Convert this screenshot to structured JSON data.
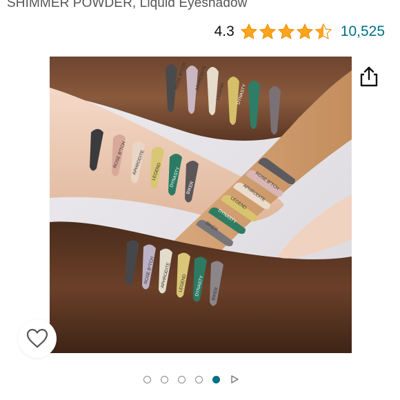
{
  "product": {
    "title": "SHIMMER POWDER, Liquid Eyeshadow"
  },
  "rating": {
    "value": "4.3",
    "stars": 4.3,
    "count": "10,525",
    "star_color": "#ffa41c"
  },
  "swatches": {
    "arm_top": [
      "ROSE B*TCH",
      "APHRODITE",
      "LEGEND",
      "DYNASTY"
    ],
    "arm_left": [
      "ROSE B*TCH",
      "APHRODITE",
      "LEGEND",
      "DYNASTY",
      "BIKER"
    ],
    "arm_right": [
      "ROSE B*TCH",
      "APHRODITE",
      "LEGEND",
      "DYNASTY",
      "BIKER"
    ],
    "arm_bottom": [
      "ROSE B*TCH",
      "APHRODITE",
      "LEGEND",
      "DYNASTY",
      "BIKER"
    ]
  },
  "carousel": {
    "total": 5,
    "active_index": 5
  },
  "colors": {
    "link": "#007185",
    "accent": "#ffa41c"
  }
}
